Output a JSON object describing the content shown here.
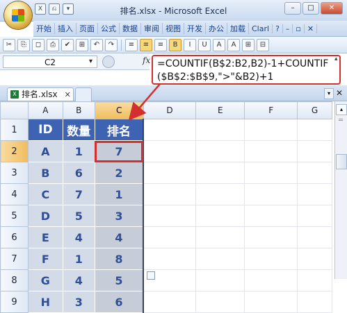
{
  "window": {
    "title": "排名.xlsx - Microsoft Excel",
    "minimize_label": "–",
    "maximize_label": "□",
    "close_label": "✕"
  },
  "quick_access": [
    "X",
    "⎌",
    "▾"
  ],
  "ribbon_tabs": [
    "开始",
    "插入",
    "页面",
    "公式",
    "数据",
    "审阅",
    "视图",
    "开发",
    "办公",
    "加载",
    "Clarl"
  ],
  "ribbon_extras": {
    "help": "?",
    "min": "–",
    "restore": "▫",
    "close": "✕"
  },
  "toolbar_icons": [
    "✂",
    "⎘",
    "◻",
    "⎙",
    "✔",
    "⊞",
    "↶",
    "↷",
    "≡",
    "≡",
    "≡",
    "B",
    "I",
    "U",
    "A",
    "A",
    "⊞",
    "⊟"
  ],
  "formula_bar": {
    "name_box": "C2",
    "fx": "fx",
    "formula": "=COUNTIF(B$2:B2,B2)-1+COUNTIF($B$2:$B$9,\">\"&B2)+1"
  },
  "workbook_tab": {
    "name": "排名.xlsx",
    "close": "✕"
  },
  "grid": {
    "columns": [
      "A",
      "B",
      "C",
      "D",
      "E",
      "F",
      "G"
    ],
    "rows": [
      "1",
      "2",
      "3",
      "4",
      "5",
      "6",
      "7",
      "8",
      "9"
    ],
    "header_row": [
      "ID",
      "数量",
      "排名"
    ],
    "data": [
      [
        "A",
        "1",
        "7"
      ],
      [
        "B",
        "6",
        "2"
      ],
      [
        "C",
        "7",
        "1"
      ],
      [
        "D",
        "5",
        "3"
      ],
      [
        "E",
        "4",
        "4"
      ],
      [
        "F",
        "1",
        "8"
      ],
      [
        "G",
        "4",
        "5"
      ],
      [
        "H",
        "3",
        "6"
      ]
    ],
    "active_cell": "C2"
  },
  "colors": {
    "header_fill": "#3e63b3",
    "data_fill": "#d4dbe8",
    "highlight": "#d42f2f"
  }
}
